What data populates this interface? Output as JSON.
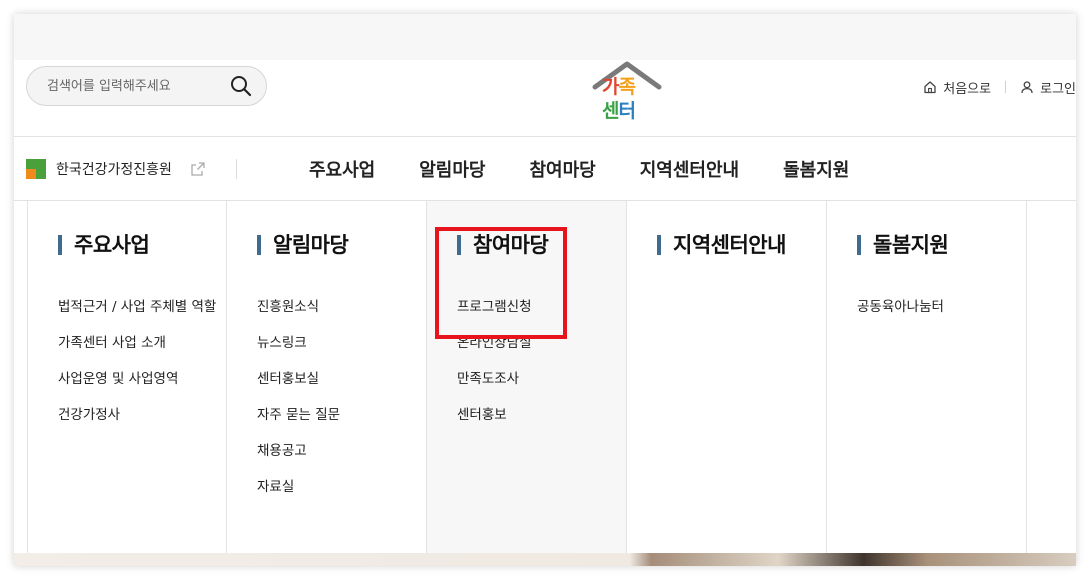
{
  "search": {
    "placeholder": "검색어를 입력해주세요"
  },
  "icons": {
    "search": "search-icon",
    "home": "home-icon",
    "user": "user-icon",
    "external_link": "external-link-icon"
  },
  "logo": {
    "line1": "가족",
    "line2": "센터"
  },
  "utility": {
    "home_label": "처음으로",
    "login_label": "로그인"
  },
  "nav": {
    "org_name": "한국건강가정진흥원",
    "menu": [
      "주요사업",
      "알림마당",
      "참여마당",
      "지역센터안내",
      "돌봄지원"
    ]
  },
  "mega_menu": {
    "columns": [
      {
        "title": "주요사업",
        "items": [
          "법적근거 / 사업 주체별 역할",
          "가족센터 사업 소개",
          "사업운영 및 사업영역",
          "건강가정사"
        ]
      },
      {
        "title": "알림마당",
        "items": [
          "진흥원소식",
          "뉴스링크",
          "센터홍보실",
          "자주 묻는 질문",
          "채용공고",
          "자료실"
        ]
      },
      {
        "title": "참여마당",
        "items": [
          "프로그램신청",
          "온라인상담실",
          "만족도조사",
          "센터홍보"
        ]
      },
      {
        "title": "지역센터안내",
        "items": []
      },
      {
        "title": "돌봄지원",
        "items": [
          "공동육아나눔터"
        ]
      }
    ]
  },
  "colors": {
    "accent_bar": "#3f6b8c",
    "highlight": "#e8141c",
    "active_column_bg": "#f7f7f7"
  }
}
